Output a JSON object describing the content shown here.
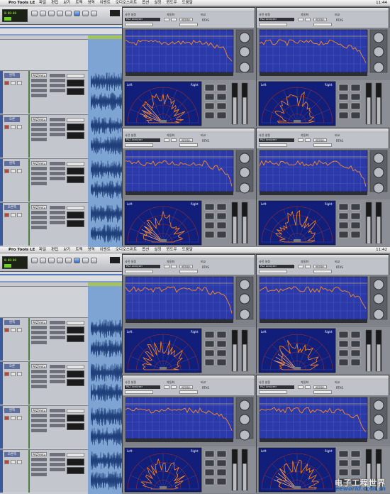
{
  "app_title": "Pro Tools LE",
  "menus": [
    "파일",
    "편집",
    "보기",
    "트랙",
    "영역",
    "이벤트",
    "오디오스위트",
    "옵션",
    "설정",
    "윈도우",
    "도움말"
  ],
  "clocks": [
    "11:44",
    "11:42"
  ],
  "tracks": [
    {
      "name": "왼쪽",
      "insert": "PAZ/Antu"
    },
    {
      "name": "오른",
      "insert": "PAZ/Antu"
    },
    {
      "name": "왼쪽",
      "insert": "PAZ/Antu"
    },
    {
      "name": "오른쪽",
      "insert": "PAZ/Antu"
    }
  ],
  "counter_text": "0:00:00",
  "plugin": {
    "preset_label": "사전 설정",
    "auto_label": "자동화",
    "compare_label": "비교",
    "preset_name": "PAZ Analyzer",
    "bypass": "바이패스",
    "native": "RTAS",
    "left_label": "Left",
    "right_label": "Right"
  },
  "watermark": {
    "cn": "电子工程世界",
    "url": "eeworld.com.cn"
  },
  "colors": {
    "spectrum_bg": "#2b3aa8",
    "spectrum_line": "#ff8a1e",
    "polar_bg": "#111e7a",
    "accent_green": "#6fd12a"
  }
}
